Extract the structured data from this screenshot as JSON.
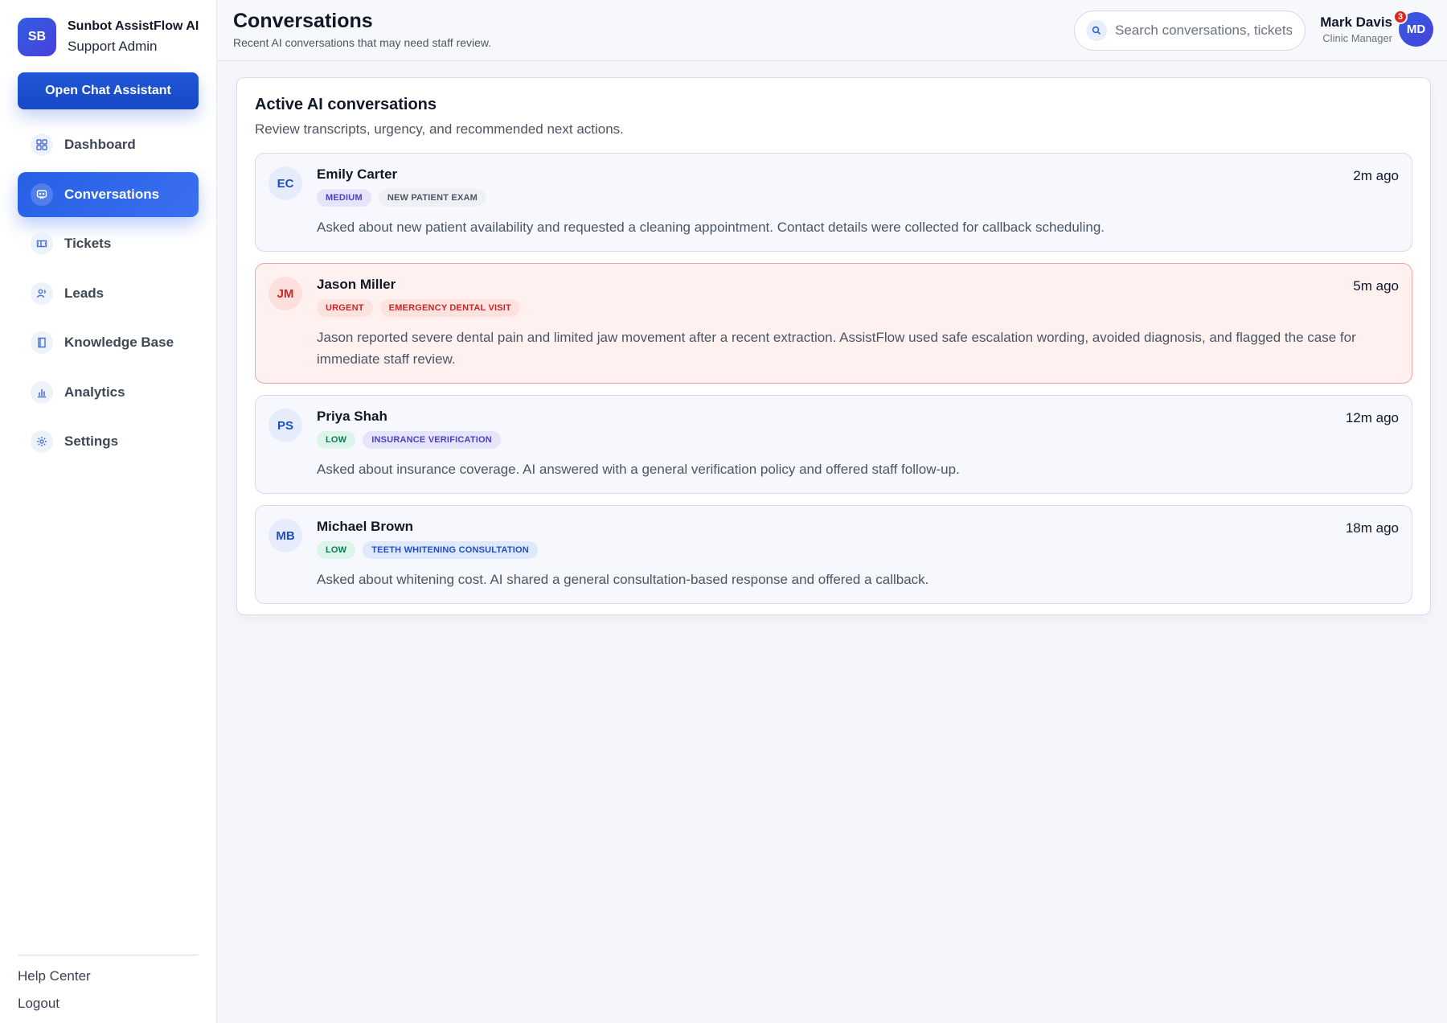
{
  "brand": {
    "logo_initials": "SB",
    "name": "Sunbot AssistFlow AI",
    "role": "Support Admin"
  },
  "sidebar": {
    "cta_label": "Open Chat Assistant",
    "items": [
      {
        "label": "Dashboard",
        "icon": "grid-icon",
        "active": false
      },
      {
        "label": "Conversations",
        "icon": "chat-icon",
        "active": true
      },
      {
        "label": "Tickets",
        "icon": "ticket-icon",
        "active": false
      },
      {
        "label": "Leads",
        "icon": "users-icon",
        "active": false
      },
      {
        "label": "Knowledge Base",
        "icon": "book-icon",
        "active": false
      },
      {
        "label": "Analytics",
        "icon": "bar-chart-icon",
        "active": false
      },
      {
        "label": "Settings",
        "icon": "gear-icon",
        "active": false
      }
    ],
    "footer": {
      "help": "Help Center",
      "logout": "Logout"
    }
  },
  "header": {
    "title": "Conversations",
    "subtitle": "Recent AI conversations that may need staff review.",
    "search_placeholder": "Search conversations, tickets",
    "user": {
      "name": "Mark Davis",
      "role": "Clinic Manager",
      "initials": "MD",
      "notifications": "3"
    }
  },
  "main": {
    "title": "Active AI conversations",
    "subtitle": "Review transcripts, urgency, and recommended next actions.",
    "conversations": [
      {
        "initials": "EC",
        "name": "Emily Carter",
        "time": "2m ago",
        "priority": "MEDIUM",
        "topic": "NEW PATIENT EXAM",
        "summary": "Asked about new patient availability and requested a cleaning appointment. Contact details were collected for callback scheduling."
      },
      {
        "initials": "JM",
        "name": "Jason Miller",
        "time": "5m ago",
        "priority": "URGENT",
        "topic": "EMERGENCY DENTAL VISIT",
        "summary": "Jason reported severe dental pain and limited jaw movement after a recent extraction. AssistFlow used safe escalation wording, avoided diagnosis, and flagged the case for immediate staff review."
      },
      {
        "initials": "PS",
        "name": "Priya Shah",
        "time": "12m ago",
        "priority": "LOW",
        "topic": "INSURANCE VERIFICATION",
        "summary": "Asked about insurance coverage. AI answered with a general verification policy and offered staff follow-up."
      },
      {
        "initials": "MB",
        "name": "Michael Brown",
        "time": "18m ago",
        "priority": "LOW",
        "topic": "TEETH WHITENING CONSULTATION",
        "summary": "Asked about whitening cost. AI shared a general consultation-based response and offered a callback."
      }
    ]
  },
  "colors": {
    "accent": "#2660e6",
    "urgent": "#c62828",
    "low": "#0f7a52",
    "medium": "#4b3fc4"
  }
}
